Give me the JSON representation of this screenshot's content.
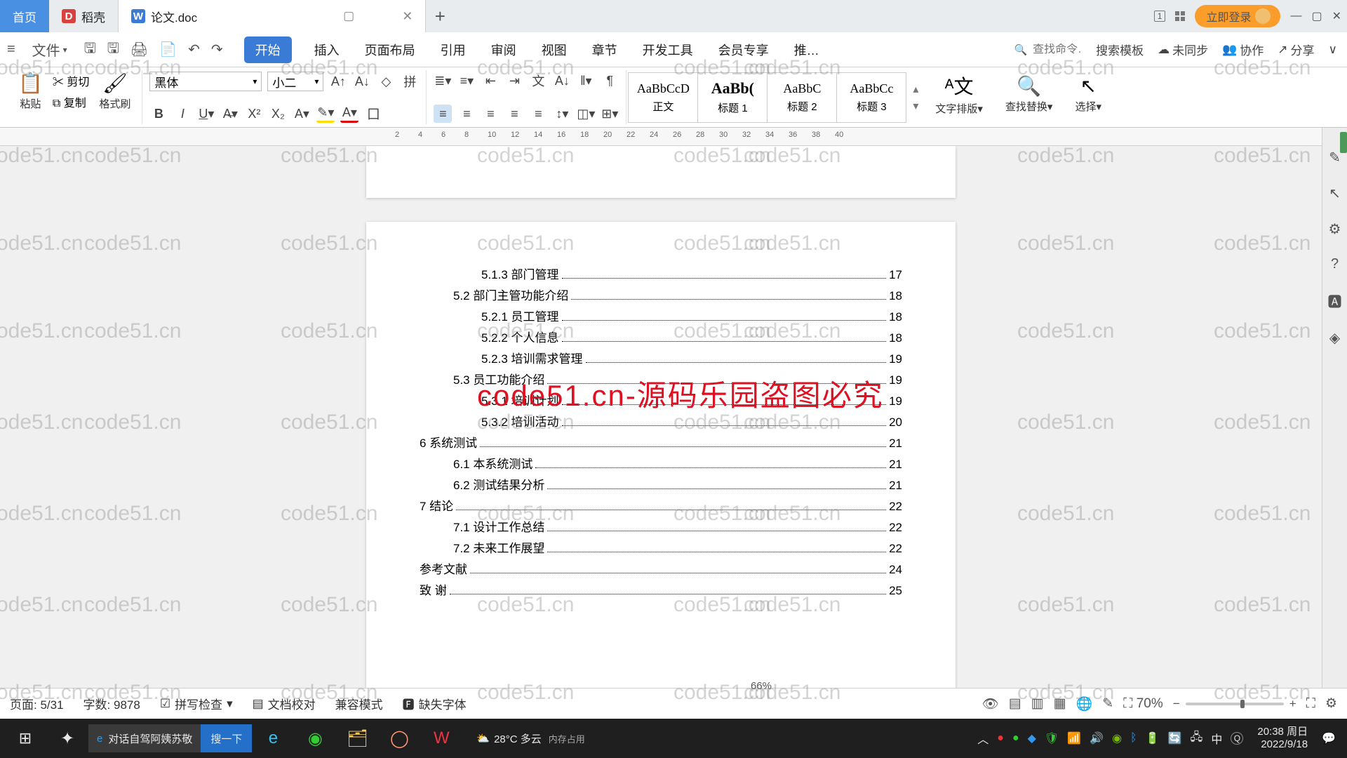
{
  "titlebar": {
    "home": "首页",
    "daoke": "稻壳",
    "doc": "论文.doc",
    "login": "立即登录"
  },
  "menu": {
    "file": "文件",
    "tabs": [
      "开始",
      "插入",
      "页面布局",
      "引用",
      "审阅",
      "视图",
      "章节",
      "开发工具",
      "会员专享",
      "推…"
    ],
    "search_cmd": "查找命令…",
    "search_tpl": "搜索模板",
    "unsync": "未同步",
    "coop": "协作",
    "share": "分享"
  },
  "ribbon": {
    "paste": "粘贴",
    "cut": "剪切",
    "copy": "复制",
    "brush": "格式刷",
    "font": "黑体",
    "size": "小二",
    "styles": [
      {
        "prev": "AaBbCcD",
        "cap": "正文"
      },
      {
        "prev": "AaBb(",
        "cap": "标题 1",
        "bold": true
      },
      {
        "prev": "AaBbC",
        "cap": "标题 2"
      },
      {
        "prev": "AaBbCc",
        "cap": "标题 3"
      }
    ],
    "textdir": "文字排版",
    "findrep": "查找替换",
    "select": "选择"
  },
  "toc": [
    {
      "ind": 3,
      "t": "5.1.3 部门管理",
      "p": "17"
    },
    {
      "ind": 2,
      "t": "5.2 部门主管功能介绍",
      "p": "18"
    },
    {
      "ind": 3,
      "t": "5.2.1 员工管理",
      "p": "18"
    },
    {
      "ind": 3,
      "t": "5.2.2 个人信息",
      "p": "18"
    },
    {
      "ind": 3,
      "t": "5.2.3 培训需求管理",
      "p": "19"
    },
    {
      "ind": 2,
      "t": "5.3 员工功能介绍",
      "p": "19"
    },
    {
      "ind": 3,
      "t": "5.3.1 培训计划",
      "p": "19"
    },
    {
      "ind": 3,
      "t": "5.3.2 培训活动",
      "p": "20"
    },
    {
      "ind": 1,
      "t": "6 系统测试",
      "p": "21"
    },
    {
      "ind": 2,
      "t": "6.1 本系统测试",
      "p": "21"
    },
    {
      "ind": 2,
      "t": "6.2 测试结果分析",
      "p": "21"
    },
    {
      "ind": 1,
      "t": "7 结论",
      "p": "22"
    },
    {
      "ind": 2,
      "t": "7.1 设计工作总结",
      "p": "22"
    },
    {
      "ind": 2,
      "t": "7.2 未来工作展望",
      "p": "22"
    },
    {
      "ind": 1,
      "t": "参考文献",
      "p": "24"
    },
    {
      "ind": 1,
      "t": "致    谢",
      "p": "25"
    }
  ],
  "status": {
    "page": "页面: 5/31",
    "words": "字数: 9878",
    "spell": "拼写检查",
    "proof": "文档校对",
    "compat": "兼容模式",
    "missing": "缺失字体",
    "zoom": "70%",
    "subzoom": "66%"
  },
  "taskbar": {
    "search_label": "对话自驾阿姨苏敬",
    "search_btn": "搜一下",
    "weather": "28°C 多云",
    "mem": "内存占用",
    "input": "中",
    "time": "20:38 周日",
    "date": "2022/9/18"
  },
  "watermark": {
    "grey": "code51.cn",
    "red": "code51.cn-源码乐园盗图必究"
  }
}
